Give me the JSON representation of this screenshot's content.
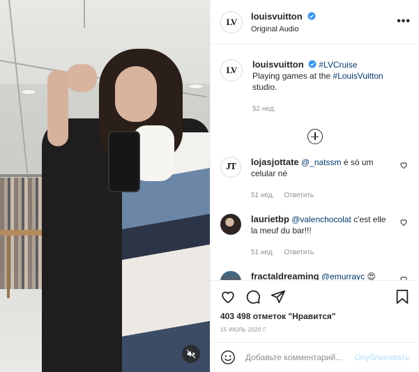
{
  "post_media": {
    "mute_icon": "speaker-muted-icon"
  },
  "header": {
    "avatar_text": "LV",
    "username": "louisvuitton",
    "audio": "Original Audio",
    "more_icon": "•••"
  },
  "caption": {
    "avatar_text": "LV",
    "username": "louisvuitton",
    "hashtag1": "#LVCruise",
    "text_part1": "Playing games at the ",
    "hashtag2": "#LouisVuitton",
    "text_part2": " studio.",
    "time": "52 нед."
  },
  "comments": [
    {
      "avatar_text": "JT",
      "username": "lojasjottate",
      "mention": "@_natssm",
      "text": " é só um celular né",
      "time": "51 нед.",
      "reply": "Ответить"
    },
    {
      "username": "laurietbp",
      "mention": "@valenchocolat",
      "text": " c'est elle la meuf du bar!!!",
      "time": "51 нед.",
      "reply": "Ответить"
    },
    {
      "username": "fractaldreaming",
      "mention": "@emurrayc",
      "text": " 😍"
    }
  ],
  "actions": {
    "likes": "403 498 отметок \"Нравится\"",
    "date": "15 ИЮЛЬ 2020 Г."
  },
  "add_comment": {
    "placeholder": "Добавьте комментарий...",
    "post_label": "Опубликовать"
  },
  "colors": {
    "verified": "#3897f0",
    "link": "#00376b",
    "muted_text": "#8e8e8e",
    "post_disabled": "#b2dffc"
  }
}
